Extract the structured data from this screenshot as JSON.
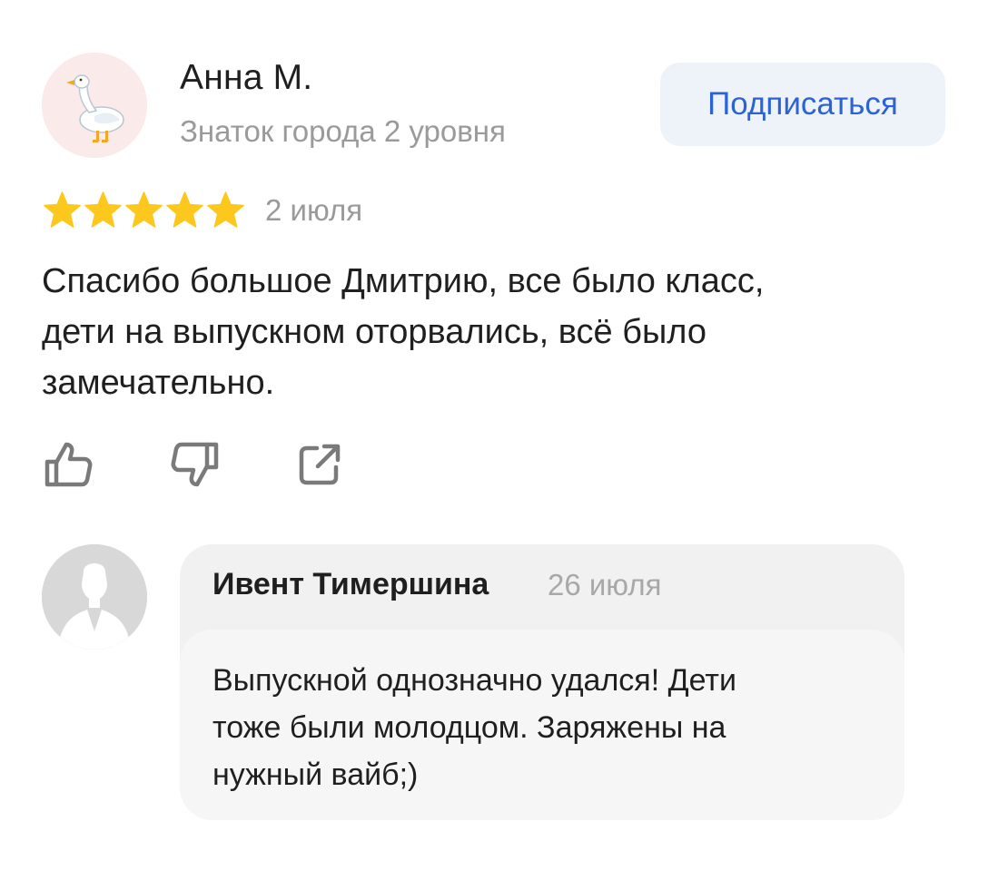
{
  "review": {
    "author": {
      "name": "Анна М.",
      "level": "Знаток города 2 уровня",
      "avatar_icon": "goose-icon"
    },
    "subscribe_label": "Подписаться",
    "rating": 5,
    "rating_max": 5,
    "date": "2 июля",
    "text": "Спасибо большое Дмитрию,  все было класс,\nдети на выпускном оторвались,  всё было\nзамечательно.",
    "actions": {
      "like_icon": "thumbs-up-icon",
      "dislike_icon": "thumbs-down-icon",
      "share_icon": "share-icon"
    }
  },
  "reply": {
    "author": "Ивент Тимершина",
    "date": "26 июля",
    "avatar_icon": "default-user-icon",
    "text": "Выпускной однозначно удался! Дети\nтоже были молодцом. Заряжены на\nнужный вайб;)"
  },
  "colors": {
    "star": "#fcc81d",
    "accent": "#2a63d4",
    "muted_text": "#9a9a9a",
    "subscribe_bg": "#eef2f9",
    "reply_header_bg": "#f1f1f1",
    "reply_body_bg": "#f6f6f6",
    "icon": "#7a7a7a"
  }
}
